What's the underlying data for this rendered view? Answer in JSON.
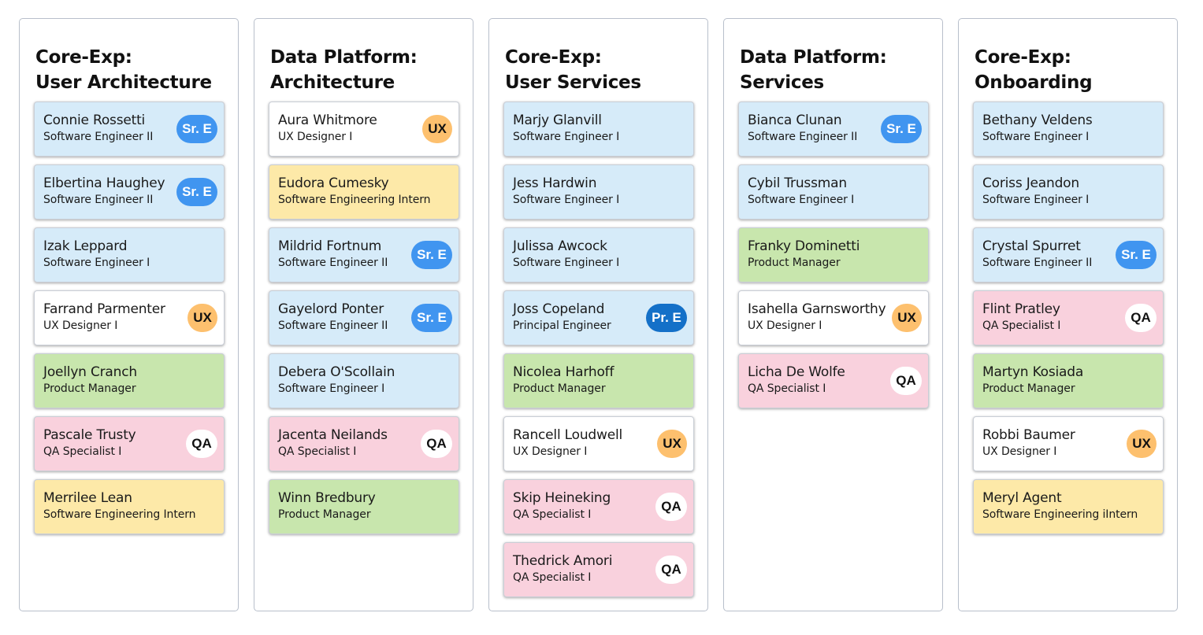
{
  "role_colors": {
    "se": "#d6ebf9",
    "ux": "#ffffff",
    "intern": "#fde9a8",
    "pm": "#c8e6ad",
    "qa": "#f9d1dd"
  },
  "badge_colors": {
    "sr": "#4095f0",
    "pr": "#1470c8",
    "ux": "#fdc06e",
    "qa": "#ffffff"
  },
  "columns": [
    {
      "title_line1": "Core-Exp:",
      "title_line2": "User Architecture",
      "cards": [
        {
          "name": "Connie Rossetti",
          "title": "Software Engineer II",
          "role": "se",
          "badge": "Sr. E",
          "badge_type": "sr"
        },
        {
          "name": "Elbertina Haughey",
          "title": "Software Engineer II",
          "role": "se",
          "badge": "Sr. E",
          "badge_type": "sr"
        },
        {
          "name": "Izak Leppard",
          "title": "Software Engineer I",
          "role": "se",
          "badge": "",
          "badge_type": ""
        },
        {
          "name": "Farrand Parmenter",
          "title": "UX Designer I",
          "role": "ux",
          "badge": "UX",
          "badge_type": "ux"
        },
        {
          "name": "Joellyn Cranch",
          "title": "Product Manager",
          "role": "pm",
          "badge": "",
          "badge_type": ""
        },
        {
          "name": "Pascale Trusty",
          "title": "QA Specialist I",
          "role": "qa",
          "badge": "QA",
          "badge_type": "qa"
        },
        {
          "name": "Merrilee Lean",
          "title": "Software Engineering Intern",
          "role": "intern",
          "badge": "",
          "badge_type": ""
        }
      ]
    },
    {
      "title_line1": "Data Platform:",
      "title_line2": "Architecture",
      "cards": [
        {
          "name": "Aura Whitmore",
          "title": "UX Designer I",
          "role": "ux",
          "badge": "UX",
          "badge_type": "ux"
        },
        {
          "name": "Eudora Cumesky",
          "title": "Software Engineering Intern",
          "role": "intern",
          "badge": "",
          "badge_type": ""
        },
        {
          "name": "Mildrid Fortnum",
          "title": "Software Engineer II",
          "role": "se",
          "badge": "Sr. E",
          "badge_type": "sr"
        },
        {
          "name": "Gayelord Ponter",
          "title": "Software Engineer II",
          "role": "se",
          "badge": "Sr. E",
          "badge_type": "sr"
        },
        {
          "name": "Debera O'Scollain",
          "title": "Software Engineer I",
          "role": "se",
          "badge": "",
          "badge_type": ""
        },
        {
          "name": "Jacenta Neilands",
          "title": "QA Specialist I",
          "role": "qa",
          "badge": "QA",
          "badge_type": "qa"
        },
        {
          "name": "Winn Bredbury",
          "title": "Product Manager",
          "role": "pm",
          "badge": "",
          "badge_type": ""
        }
      ]
    },
    {
      "title_line1": "Core-Exp:",
      "title_line2": "User Services",
      "cards": [
        {
          "name": "Marjy Glanvill",
          "title": "Software Engineer I",
          "role": "se",
          "badge": "",
          "badge_type": ""
        },
        {
          "name": "Jess Hardwin",
          "title": "Software Engineer I",
          "role": "se",
          "badge": "",
          "badge_type": ""
        },
        {
          "name": "Julissa Awcock",
          "title": "Software Engineer I",
          "role": "se",
          "badge": "",
          "badge_type": ""
        },
        {
          "name": "Joss Copeland",
          "title": "Principal Engineer",
          "role": "se",
          "badge": "Pr. E",
          "badge_type": "pr"
        },
        {
          "name": "Nicolea Harhoff",
          "title": "Product Manager",
          "role": "pm",
          "badge": "",
          "badge_type": ""
        },
        {
          "name": "Rancell Loudwell",
          "title": "UX Designer I",
          "role": "ux",
          "badge": "UX",
          "badge_type": "ux"
        },
        {
          "name": "Skip Heineking",
          "title": "QA Specialist I",
          "role": "qa",
          "badge": "QA",
          "badge_type": "qa"
        },
        {
          "name": "Thedrick Amori",
          "title": "QA Specialist I",
          "role": "qa",
          "badge": "QA",
          "badge_type": "qa"
        }
      ]
    },
    {
      "title_line1": "Data Platform:",
      "title_line2": "Services",
      "cards": [
        {
          "name": "Bianca Clunan",
          "title": "Software Engineer II",
          "role": "se",
          "badge": "Sr. E",
          "badge_type": "sr"
        },
        {
          "name": "Cybil Trussman",
          "title": "Software Engineer I",
          "role": "se",
          "badge": "",
          "badge_type": ""
        },
        {
          "name": "Franky Dominetti",
          "title": "Product Manager",
          "role": "pm",
          "badge": "",
          "badge_type": ""
        },
        {
          "name": "Isahella Garnsworthy",
          "title": "UX Designer I",
          "role": "ux",
          "badge": "UX",
          "badge_type": "ux"
        },
        {
          "name": "Licha De Wolfe",
          "title": "QA Specialist I",
          "role": "qa",
          "badge": "QA",
          "badge_type": "qa"
        }
      ]
    },
    {
      "title_line1": "Core-Exp:",
      "title_line2": "Onboarding",
      "cards": [
        {
          "name": "Bethany Veldens",
          "title": "Software Engineer I",
          "role": "se",
          "badge": "",
          "badge_type": ""
        },
        {
          "name": "Coriss Jeandon",
          "title": "Software Engineer I",
          "role": "se",
          "badge": "",
          "badge_type": ""
        },
        {
          "name": "Crystal Spurret",
          "title": "Software Engineer II",
          "role": "se",
          "badge": "Sr. E",
          "badge_type": "sr"
        },
        {
          "name": "Flint Pratley",
          "title": "QA Specialist I",
          "role": "qa",
          "badge": "QA",
          "badge_type": "qa"
        },
        {
          "name": "Martyn Kosiada",
          "title": "Product Manager",
          "role": "pm",
          "badge": "",
          "badge_type": ""
        },
        {
          "name": "Robbi Baumer",
          "title": "UX Designer I",
          "role": "ux",
          "badge": "UX",
          "badge_type": "ux"
        },
        {
          "name": "Meryl Agent",
          "title": "Software Engineering iIntern",
          "role": "intern",
          "badge": "",
          "badge_type": ""
        }
      ]
    }
  ]
}
